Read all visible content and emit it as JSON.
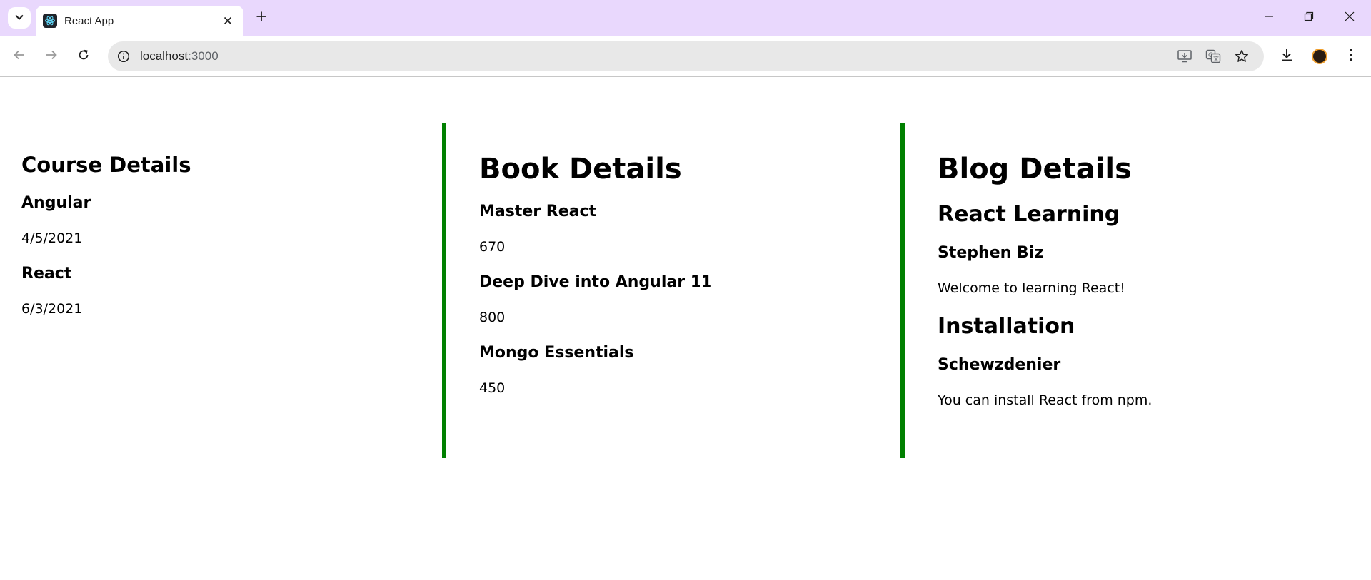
{
  "browser": {
    "tab_title": "React App",
    "url_host": "localhost",
    "url_port": ":3000"
  },
  "course": {
    "heading": "Course Details",
    "items": [
      {
        "name": "Angular",
        "date": "4/5/2021"
      },
      {
        "name": "React",
        "date": "6/3/2021"
      }
    ]
  },
  "book": {
    "heading": "Book Details",
    "items": [
      {
        "name": "Master React",
        "price": "670"
      },
      {
        "name": "Deep Dive into Angular 11",
        "price": "800"
      },
      {
        "name": "Mongo Essentials",
        "price": "450"
      }
    ]
  },
  "blog": {
    "heading": "Blog Details",
    "items": [
      {
        "title": "React Learning",
        "author": "Stephen Biz",
        "content": "Welcome to learning React!"
      },
      {
        "title": "Installation",
        "author": "Schewzdenier",
        "content": "You can install React from npm."
      }
    ]
  },
  "colors": {
    "tabstrip": "#e9d8fd",
    "divider": "#008000"
  },
  "icons": [
    "tab-search-icon",
    "react-favicon-icon",
    "close-icon",
    "plus-icon",
    "minimize-icon",
    "restore-icon",
    "window-close-icon",
    "back-arrow-icon",
    "forward-arrow-icon",
    "reload-icon",
    "info-icon",
    "install-app-icon",
    "translate-icon",
    "bookmark-star-icon",
    "download-icon",
    "more-vert-icon"
  ]
}
